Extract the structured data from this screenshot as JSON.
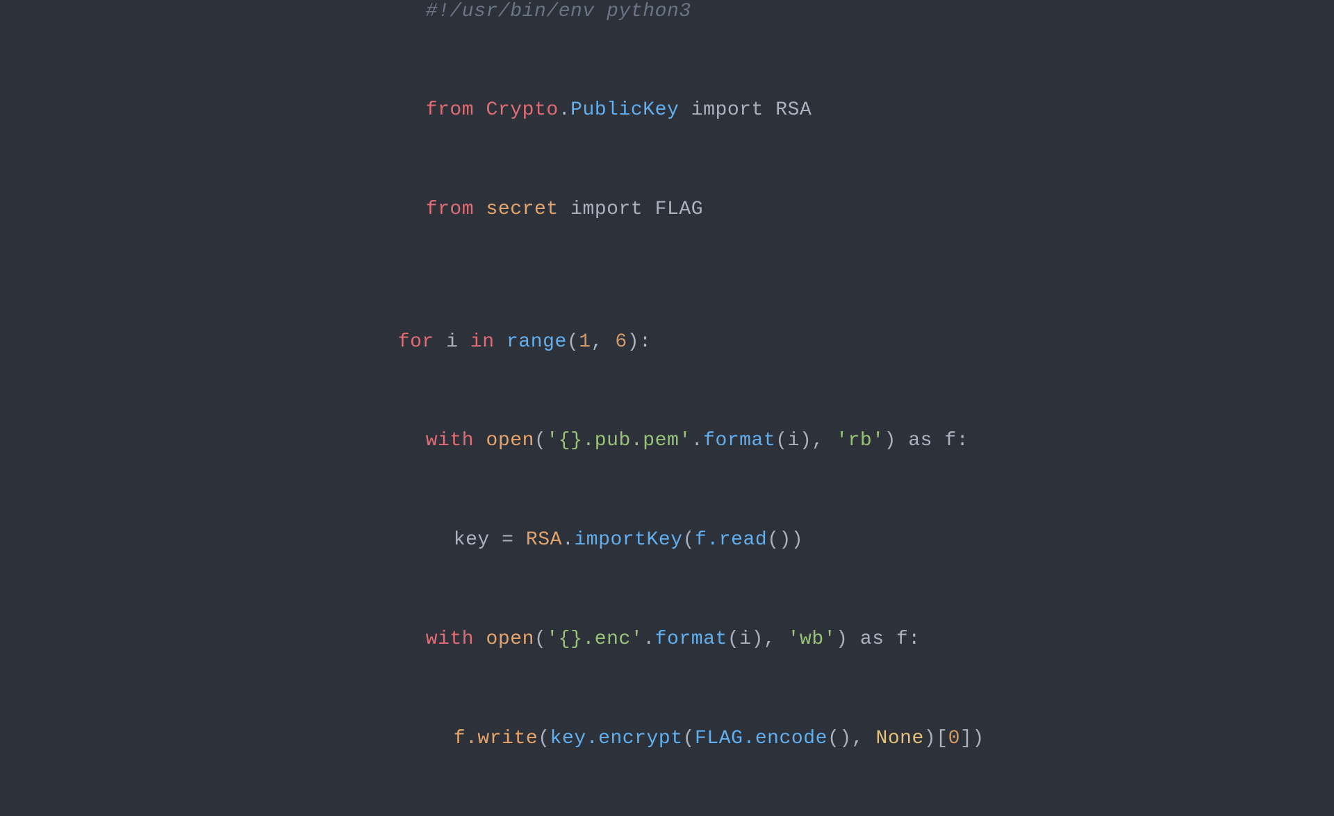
{
  "bg_color": "#2d3139",
  "code": {
    "line1_comment": "#!/usr/bin/env python3",
    "line2": "from Crypto.PublicKey import RSA",
    "line3": "from secret import FLAG",
    "line5": "for i in range(1, 6):",
    "line6": "    with open('{}.pub.pem'.format(i), 'rb') as f:",
    "line7": "        key = RSA.importKey(f.read())",
    "line8": "    with open('{}.enc'.format(i), 'wb') as f:",
    "line9": "        f.write(key.encrypt(FLAG.encode(), None)[0])"
  }
}
